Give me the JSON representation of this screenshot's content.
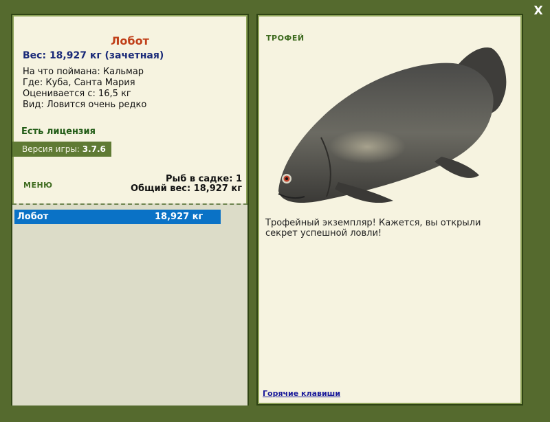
{
  "window": {
    "close_icon": "close-icon",
    "close_symbol": "X"
  },
  "fish": {
    "name": "Лобот",
    "weight_line": "Вес: 18,927 кг (зачетная)",
    "caught_on": "На что поймана: Кальмар",
    "location": "Где: Куба, Санта Мария",
    "valued_from": "Оценивается с: 16,5 кг",
    "rarity": "Вид: Ловится очень редко"
  },
  "license": "Есть лицензия",
  "version": {
    "label": "Версия игры:",
    "value": "3.7.6"
  },
  "menu": {
    "label": "МЕНЮ"
  },
  "cage": {
    "fish_count": "Рыб в садке: 1",
    "total_weight": "Общий вес: 18,927 кг"
  },
  "catch_list": [
    {
      "name": "Лобот",
      "weight": "18,927 кг"
    }
  ],
  "trophy": {
    "label": "ТРОФЕЙ",
    "description": "Трофейный экземпляр! Кажется, вы открыли секрет успешной ловли!",
    "image_icon": "fish-tripletail-image"
  },
  "hotkeys_link": "Горячие клавиши",
  "colors": {
    "frame": "#556a2e",
    "panel": "#f6f3e0",
    "title": "#c0401a",
    "weight": "#1a2a78",
    "selection": "#0a72c6",
    "accent_green": "#3d6a1e"
  }
}
